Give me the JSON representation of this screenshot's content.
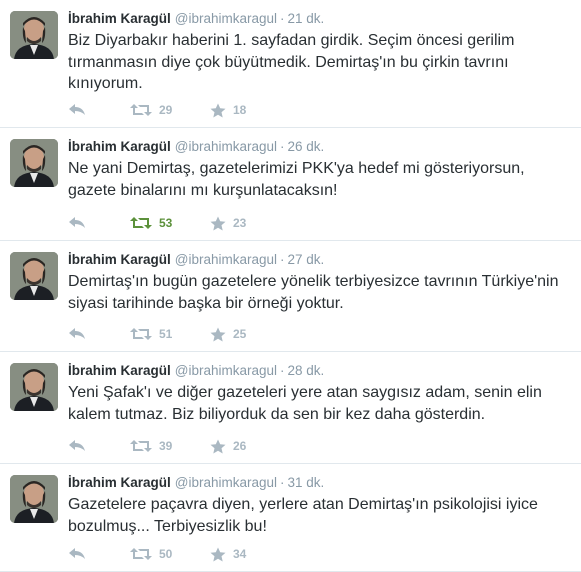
{
  "colors": {
    "name": "#292f33",
    "meta": "#8899a6",
    "action": "#aab8c2",
    "retweeted": "#5c913b",
    "divider": "#e1e8ed"
  },
  "tweets": [
    {
      "fullname": "İbrahim Karagül",
      "username": "@ibrahimkaragul",
      "separator": "·",
      "time": "21 dk.",
      "text": "Biz Diyarbakır haberini 1. sayfadan girdik. Seçim öncesi gerilim tırmanmasın diye çok büyütmedik. Demirtaş'ın bu çirkin tavrını kınıyorum.",
      "retweets": "29",
      "favorites": "18",
      "retweeted": false
    },
    {
      "fullname": "İbrahim Karagül",
      "username": "@ibrahimkaragul",
      "separator": "·",
      "time": "26 dk.",
      "text": "Ne yani Demirtaş, gazetelerimizi PKK'ya hedef mi gösteriyorsun, gazete binalarını mı kurşunlatacaksın!",
      "retweets": "53",
      "favorites": "23",
      "retweeted": true
    },
    {
      "fullname": "İbrahim Karagül",
      "username": "@ibrahimkaragul",
      "separator": "·",
      "time": "27 dk.",
      "text": "Demirtaş'ın bugün gazetelere yönelik terbiyesizce tavrının Türkiye'nin siyasi tarihinde başka bir örneği yoktur.",
      "retweets": "51",
      "favorites": "25",
      "retweeted": false
    },
    {
      "fullname": "İbrahim Karagül",
      "username": "@ibrahimkaragul",
      "separator": "·",
      "time": "28 dk.",
      "text": "Yeni Şafak'ı ve diğer gazeteleri yere atan saygısız adam, senin elin kalem tutmaz. Biz biliyorduk da sen bir kez daha gösterdin.",
      "retweets": "39",
      "favorites": "26",
      "retweeted": false
    },
    {
      "fullname": "İbrahim Karagül",
      "username": "@ibrahimkaragul",
      "separator": "·",
      "time": "31 dk.",
      "text": "Gazetelere paçavra diyen, yerlere atan Demirtaş'ın psikolojisi iyice bozulmuş... Terbiyesizlik bu!",
      "retweets": "50",
      "favorites": "34",
      "retweeted": false
    }
  ]
}
